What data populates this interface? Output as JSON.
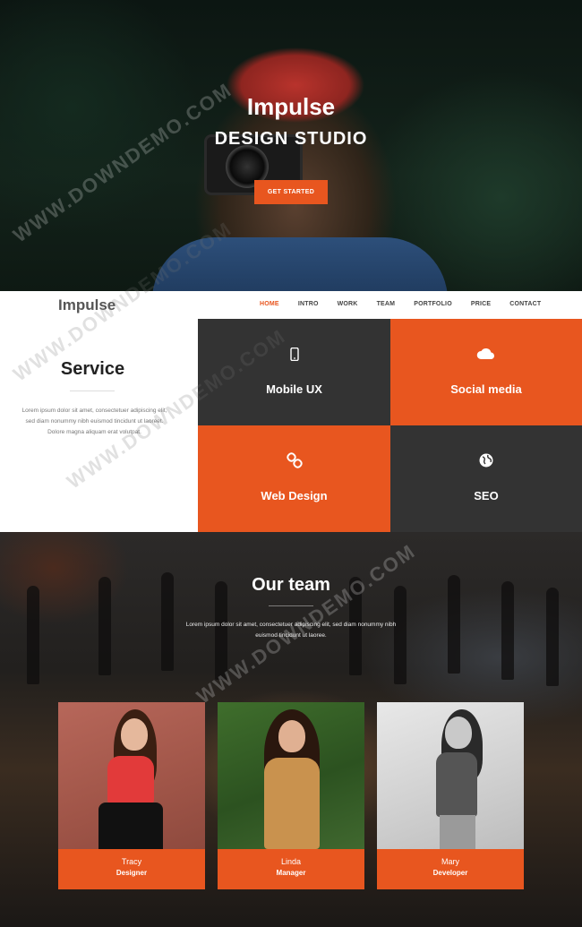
{
  "hero": {
    "title": "Impulse",
    "subtitle": "DESIGN STUDIO",
    "cta_label": "GET STARTED"
  },
  "nav": {
    "logo": "Impulse",
    "items": [
      {
        "label": "HOME",
        "active": true
      },
      {
        "label": "INTRO",
        "active": false
      },
      {
        "label": "WORK",
        "active": false
      },
      {
        "label": "TEAM",
        "active": false
      },
      {
        "label": "PORTFOLIO",
        "active": false
      },
      {
        "label": "PRICE",
        "active": false
      },
      {
        "label": "CONTACT",
        "active": false
      }
    ]
  },
  "service": {
    "title": "Service",
    "description": "Lorem ipsum dolor sit amet, consectetuer adipiscing elit, sed diam nonummy nibh euismod tincidunt ut laoreet. Dolore magna aliquam erat volutpat.",
    "tiles": [
      {
        "label": "Mobile UX",
        "icon": "mobile-phone-icon",
        "color": "#333333"
      },
      {
        "label": "Social media",
        "icon": "cloud-icon",
        "color": "#e8561f"
      },
      {
        "label": "Web Design",
        "icon": "link-icon",
        "color": "#e8561f"
      },
      {
        "label": "SEO",
        "icon": "globe-icon",
        "color": "#333333"
      }
    ]
  },
  "team": {
    "title": "Our team",
    "description": "Lorem ipsum dolor sit amet, consectetuer adipiscing elit, sed diam nonummy nibh euismod tincidunt ut laoree.",
    "members": [
      {
        "name": "Tracy",
        "role": "Designer"
      },
      {
        "name": "Linda",
        "role": "Manager"
      },
      {
        "name": "Mary",
        "role": "Developer"
      }
    ]
  },
  "watermark": "WWW.DOWNDEMO.COM",
  "colors": {
    "accent": "#e8561f",
    "dark_tile": "#333333"
  }
}
